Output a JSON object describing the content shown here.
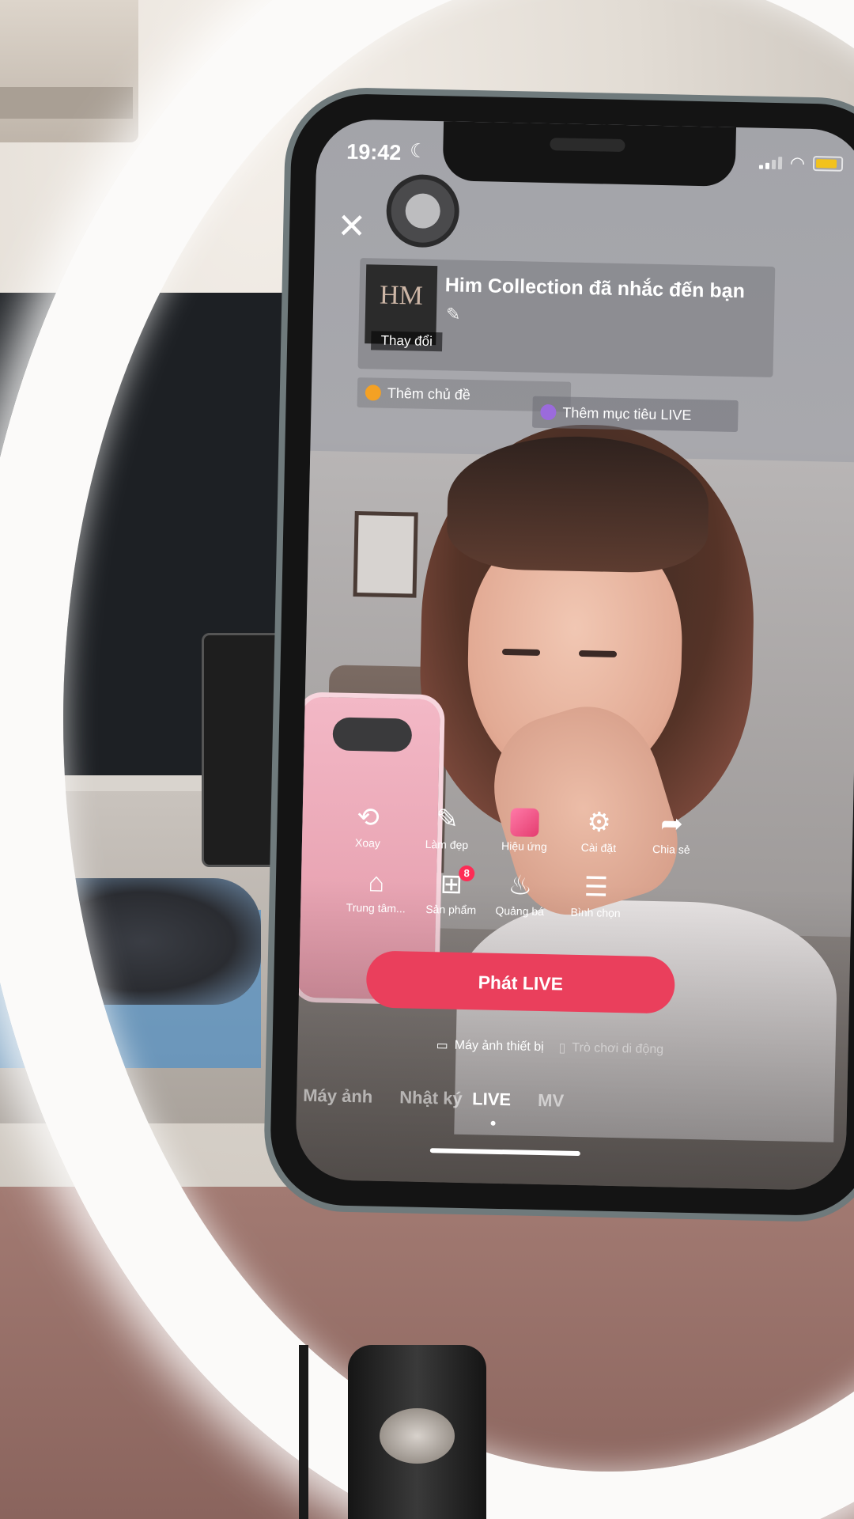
{
  "status_bar": {
    "time": "19:42",
    "moon_icon": "moon-icon",
    "battery_color": "#f2c21c"
  },
  "header": {
    "close_icon": "close-icon",
    "flip_camera_icon": "camera-flip-icon"
  },
  "live_setup": {
    "cover_logo": "HM",
    "change_cover_label": "Thay đổi",
    "title": "Him Collection đã nhắc đến bạn",
    "edit_icon": "pencil-icon",
    "topic_label": "Thêm chủ đề",
    "goal_label": "Thêm mục tiêu LIVE"
  },
  "tools_row1": [
    {
      "label": "Xoay",
      "icon": "camera-rotate-icon"
    },
    {
      "label": "Làm đẹp",
      "icon": "magic-wand-icon"
    },
    {
      "label": "Hiệu ứng",
      "icon": "effects-icon"
    },
    {
      "label": "Cài đặt",
      "icon": "gear-icon"
    },
    {
      "label": "Chia sẻ",
      "icon": "share-arrow-icon"
    }
  ],
  "tools_row2": [
    {
      "label": "Trung tâm...",
      "icon": "play-house-icon"
    },
    {
      "label": "Sản phẩm",
      "icon": "shopping-bag-icon",
      "badge": "8"
    },
    {
      "label": "Quảng bá",
      "icon": "flame-icon"
    },
    {
      "label": "Bình chọn",
      "icon": "poll-icon"
    }
  ],
  "go_live_label": "Phát LIVE",
  "go_live_color": "#ea3f5c",
  "source_options": {
    "device_camera": "Máy ảnh thiết bị",
    "mobile_gaming": "Trò chơi di động"
  },
  "mode_tabs": [
    {
      "label": "Máy ảnh",
      "active": false
    },
    {
      "label": "Nhật ký",
      "active": false
    },
    {
      "label": "LIVE",
      "active": true
    },
    {
      "label": "MV",
      "active": false
    }
  ]
}
